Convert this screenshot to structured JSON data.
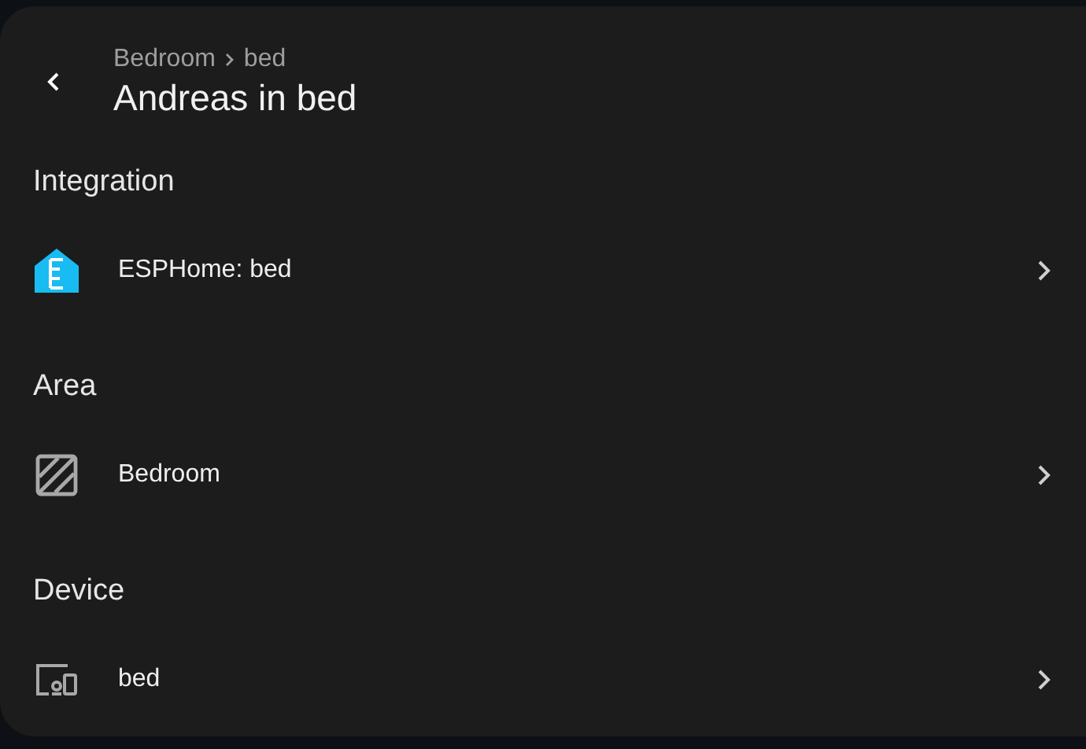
{
  "header": {
    "breadcrumb": [
      "Bedroom",
      "bed"
    ],
    "title": "Andreas in bed"
  },
  "sections": [
    {
      "title": "Integration",
      "item": {
        "kind": "integration",
        "label": "ESPHome: bed"
      }
    },
    {
      "title": "Area",
      "item": {
        "kind": "area",
        "label": "Bedroom"
      }
    },
    {
      "title": "Device",
      "item": {
        "kind": "device",
        "label": "bed"
      }
    }
  ]
}
